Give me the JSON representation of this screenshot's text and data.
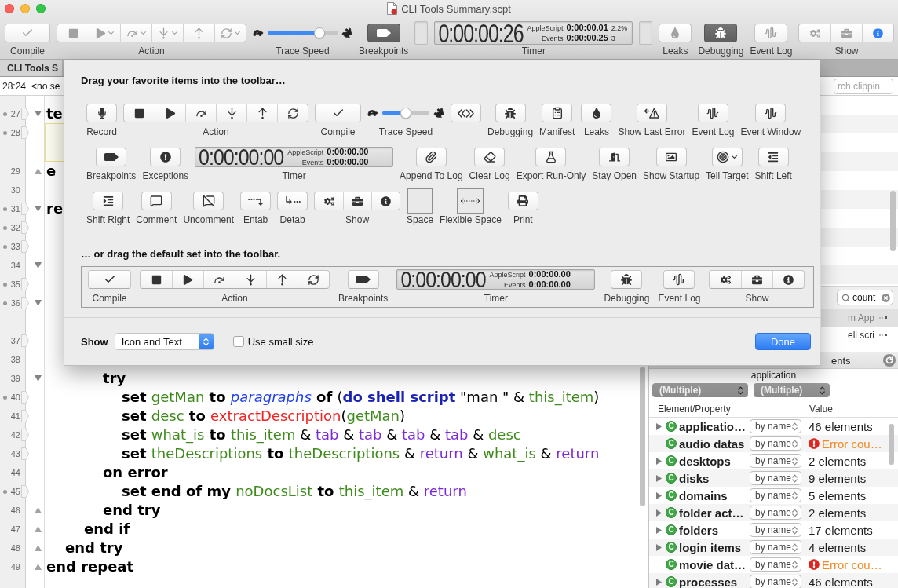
{
  "window": {
    "title": "CLI Tools Summary.scpt"
  },
  "toolbar": {
    "items": [
      {
        "kind": "compile",
        "label": "Compile",
        "disabled": true,
        "on": false
      },
      {
        "kind": "action",
        "label": "Action",
        "segments": [
          {
            "kind": "stop",
            "menu": false,
            "disabled": true
          },
          {
            "kind": "run",
            "menu": true,
            "disabled": true
          },
          {
            "kind": "stepover",
            "menu": true,
            "disabled": true
          },
          {
            "kind": "stepinto",
            "menu": true,
            "disabled": true
          },
          {
            "kind": "stepout",
            "menu": false,
            "disabled": true
          },
          {
            "kind": "loop",
            "menu": true,
            "disabled": true
          }
        ]
      },
      {
        "kind": "speed",
        "label": "Trace Speed",
        "level": 0.78
      },
      {
        "kind": "breakpoints",
        "label": "Breakpoints",
        "disabled": false,
        "on": true
      },
      {
        "kind": "flexspace"
      },
      {
        "kind": "timer",
        "label": "Timer",
        "display": "0:00:00:26",
        "script_label": "AppleScript",
        "script_time": "0:00:00.01",
        "script_share": "2.2%",
        "events_label": "Events",
        "events_time": "0:00:00.25",
        "events_count": "3"
      },
      {
        "kind": "flexspace"
      },
      {
        "kind": "leaks",
        "label": "Leaks",
        "disabled": true,
        "on": false
      },
      {
        "kind": "debugging",
        "label": "Debugging",
        "disabled": false,
        "on": true
      },
      {
        "kind": "eventlog",
        "label": "Event Log",
        "disabled": true,
        "on": false
      },
      {
        "kind": "show",
        "label": "Show",
        "segments": [
          {
            "kind": "library",
            "selected": false
          },
          {
            "kind": "bundle",
            "selected": false
          },
          {
            "kind": "inspector",
            "selected": true
          }
        ]
      }
    ]
  },
  "tabs": [
    {
      "label": "CLI Tools S",
      "selected": true
    }
  ],
  "navigation_bar": {
    "position": "28:24",
    "handler": "<no se"
  },
  "editor": {
    "lines": [
      {
        "number": "27",
        "dot": true,
        "marker": true,
        "wrapped": false,
        "highlighted": false,
        "opens": true,
        "closes": false,
        "tokens": [
          {
            "kind": "keyword",
            "text": "te"
          }
        ]
      },
      {
        "number": "28",
        "dot": true,
        "marker": true,
        "wrapped": true,
        "highlighted": true,
        "opens": false,
        "closes": false
      },
      {
        "number": "29",
        "dot": false,
        "marker": false,
        "wrapped": false,
        "highlighted": false,
        "opens": false,
        "closes": true,
        "tokens": [
          {
            "kind": "keyword",
            "text": "e"
          }
        ]
      },
      {
        "number": "30",
        "dot": false,
        "marker": false,
        "wrapped": false,
        "highlighted": false,
        "opens": false,
        "closes": false
      },
      {
        "number": "31",
        "dot": true,
        "marker": true,
        "wrapped": false,
        "highlighted": false,
        "opens": true,
        "closes": false,
        "tokens": [
          {
            "kind": "keyword",
            "text": "re"
          }
        ],
        "children": [
          {
            "number": "32",
            "dot": true,
            "marker": true,
            "wrapped": false,
            "highlighted": false,
            "opens": false,
            "closes": false
          },
          {
            "number": "33",
            "dot": true,
            "marker": true,
            "wrapped": false,
            "highlighted": false,
            "opens": false,
            "closes": false
          },
          {
            "number": "34",
            "dot": false,
            "marker": false,
            "wrapped": false,
            "highlighted": false,
            "opens": true,
            "closes": false,
            "children": [
              {
                "number": "35",
                "dot": true,
                "marker": true,
                "wrapped": false,
                "highlighted": false,
                "opens": false,
                "closes": false
              },
              {
                "number": "36",
                "dot": true,
                "marker": true,
                "wrapped": true,
                "highlighted": false,
                "opens": true,
                "closes": false,
                "children": [
                  {
                    "number": "37",
                    "dot": false,
                    "marker": true,
                    "wrapped": false,
                    "highlighted": false,
                    "opens": false,
                    "closes": false
                  },
                  {
                    "number": "38",
                    "dot": false,
                    "marker": false,
                    "wrapped": false,
                    "highlighted": false,
                    "opens": false,
                    "closes": false
                  },
                  {
                    "number": "39",
                    "dot": false,
                    "marker": false,
                    "wrapped": false,
                    "highlighted": false,
                    "opens": true,
                    "closes": false,
                    "tokens": [
                      {
                        "kind": "keyword",
                        "text": "try"
                      }
                    ],
                    "children": [
                      {
                        "number": "40",
                        "dot": true,
                        "marker": true,
                        "wrapped": false,
                        "highlighted": false,
                        "opens": false,
                        "closes": false,
                        "tokens": [
                          {
                            "kind": "keyword",
                            "text": "set "
                          },
                          {
                            "kind": "variable",
                            "text": "getMan"
                          },
                          {
                            "kind": "keyword",
                            "text": " to "
                          },
                          {
                            "kind": "class",
                            "text": "paragraphs"
                          },
                          {
                            "kind": "keyword",
                            "text": " of "
                          },
                          {
                            "kind": "plain",
                            "text": "("
                          },
                          {
                            "kind": "command",
                            "text": "do shell script"
                          },
                          {
                            "kind": "plain",
                            "text": " \"man \" & "
                          },
                          {
                            "kind": "variable",
                            "text": "this_item"
                          },
                          {
                            "kind": "plain",
                            "text": ")"
                          }
                        ]
                      },
                      {
                        "number": "41",
                        "dot": false,
                        "marker": true,
                        "wrapped": false,
                        "highlighted": false,
                        "opens": false,
                        "closes": false,
                        "tokens": [
                          {
                            "kind": "keyword",
                            "text": "set "
                          },
                          {
                            "kind": "variable",
                            "text": "desc"
                          },
                          {
                            "kind": "keyword",
                            "text": " to "
                          },
                          {
                            "kind": "handler",
                            "text": "extractDescription"
                          },
                          {
                            "kind": "plain",
                            "text": "("
                          },
                          {
                            "kind": "variable",
                            "text": "getMan"
                          },
                          {
                            "kind": "plain",
                            "text": ")"
                          }
                        ]
                      },
                      {
                        "number": "42",
                        "dot": false,
                        "marker": true,
                        "wrapped": false,
                        "highlighted": false,
                        "opens": false,
                        "closes": false,
                        "tokens": [
                          {
                            "kind": "keyword",
                            "text": "set "
                          },
                          {
                            "kind": "variable",
                            "text": "what_is"
                          },
                          {
                            "kind": "keyword",
                            "text": " to "
                          },
                          {
                            "kind": "variable",
                            "text": "this_item"
                          },
                          {
                            "kind": "plain",
                            "text": " & "
                          },
                          {
                            "kind": "constant",
                            "text": "tab"
                          },
                          {
                            "kind": "plain",
                            "text": " & "
                          },
                          {
                            "kind": "constant",
                            "text": "tab"
                          },
                          {
                            "kind": "plain",
                            "text": " & "
                          },
                          {
                            "kind": "constant",
                            "text": "tab"
                          },
                          {
                            "kind": "plain",
                            "text": " & "
                          },
                          {
                            "kind": "constant",
                            "text": "tab"
                          },
                          {
                            "kind": "plain",
                            "text": " & "
                          },
                          {
                            "kind": "variable",
                            "text": "desc"
                          }
                        ]
                      },
                      {
                        "number": "43",
                        "dot": false,
                        "marker": true,
                        "wrapped": false,
                        "highlighted": false,
                        "opens": false,
                        "closes": false,
                        "tokens": [
                          {
                            "kind": "keyword",
                            "text": "set "
                          },
                          {
                            "kind": "variable",
                            "text": "theDescriptions"
                          },
                          {
                            "kind": "keyword",
                            "text": " to "
                          },
                          {
                            "kind": "variable",
                            "text": "theDescriptions"
                          },
                          {
                            "kind": "plain",
                            "text": " & "
                          },
                          {
                            "kind": "constant",
                            "text": "return"
                          },
                          {
                            "kind": "plain",
                            "text": " & "
                          },
                          {
                            "kind": "variable",
                            "text": "what_is"
                          },
                          {
                            "kind": "plain",
                            "text": " & "
                          },
                          {
                            "kind": "constant",
                            "text": "return"
                          }
                        ]
                      }
                    ]
                  },
                  {
                    "number": "44",
                    "dot": false,
                    "marker": false,
                    "wrapped": false,
                    "highlighted": false,
                    "opens": false,
                    "closes": false,
                    "tokens": [
                      {
                        "kind": "keyword",
                        "text": "on error"
                      }
                    ],
                    "children": [
                      {
                        "number": "45",
                        "dot": true,
                        "marker": true,
                        "wrapped": false,
                        "highlighted": false,
                        "opens": false,
                        "closes": false,
                        "tokens": [
                          {
                            "kind": "keyword",
                            "text": "set end of my "
                          },
                          {
                            "kind": "variable",
                            "text": "noDocsList"
                          },
                          {
                            "kind": "keyword",
                            "text": " to "
                          },
                          {
                            "kind": "variable",
                            "text": "this_item"
                          },
                          {
                            "kind": "plain",
                            "text": " & "
                          },
                          {
                            "kind": "constant",
                            "text": "return"
                          }
                        ]
                      }
                    ]
                  },
                  {
                    "number": "46",
                    "dot": false,
                    "marker": false,
                    "wrapped": false,
                    "highlighted": false,
                    "opens": false,
                    "closes": true,
                    "tokens": [
                      {
                        "kind": "keyword",
                        "text": "end try"
                      }
                    ]
                  }
                ]
              },
              {
                "number": "47",
                "dot": false,
                "marker": false,
                "wrapped": false,
                "highlighted": false,
                "opens": false,
                "closes": true,
                "tokens": [
                  {
                    "kind": "keyword",
                    "text": "end if"
                  }
                ]
              }
            ]
          },
          {
            "number": "48",
            "dot": false,
            "marker": false,
            "wrapped": false,
            "highlighted": false,
            "opens": false,
            "closes": true,
            "tokens": [
              {
                "kind": "keyword",
                "text": "end try"
              }
            ]
          }
        ]
      },
      {
        "number": "49",
        "dot": false,
        "marker": false,
        "wrapped": false,
        "highlighted": false,
        "opens": false,
        "closes": true,
        "tokens": [
          {
            "kind": "keyword",
            "text": "end repeat"
          }
        ]
      }
    ]
  },
  "side_panel": {
    "search": {
      "placeholder": "rch clippin"
    },
    "filter": {
      "value": "count"
    },
    "results": [
      {
        "text": "m App",
        "selected": true
      },
      {
        "text": "ell scri",
        "selected": false
      }
    ],
    "section": "ents",
    "object": "application",
    "popups": [
      "(Multiple)",
      "(Multiple)"
    ],
    "table": {
      "columns": [
        "Element/Property",
        "Value"
      ],
      "rows": [
        {
          "name": "applicatio…",
          "badge": "C",
          "expandable": true,
          "access": "by name",
          "value": "46 elements",
          "error": false
        },
        {
          "name": "audio datas",
          "badge": "C",
          "expandable": false,
          "access": "by name",
          "value": "Error cou…",
          "error": true
        },
        {
          "name": "desktops",
          "badge": "C",
          "expandable": true,
          "access": "by name",
          "value": "2 elements",
          "error": false
        },
        {
          "name": "disks",
          "badge": "C",
          "expandable": true,
          "access": "by name",
          "value": "9 elements",
          "error": false
        },
        {
          "name": "domains",
          "badge": "C",
          "expandable": true,
          "access": "by name",
          "value": "5 elements",
          "error": false
        },
        {
          "name": "folder act…",
          "badge": "C",
          "expandable": true,
          "access": "by name",
          "value": "2 elements",
          "error": false
        },
        {
          "name": "folders",
          "badge": "C",
          "expandable": true,
          "access": "by name",
          "value": "17 elements",
          "error": false
        },
        {
          "name": "login items",
          "badge": "C",
          "expandable": true,
          "access": "by name",
          "value": "4 elements",
          "error": false
        },
        {
          "name": "movie dat…",
          "badge": "C",
          "expandable": false,
          "access": "by name",
          "value": "Error cou…",
          "error": true
        },
        {
          "name": "processes",
          "badge": "C",
          "expandable": true,
          "access": "by name",
          "value": "46 elements",
          "error": false
        }
      ]
    }
  },
  "customize_sheet": {
    "heading": "Drag your favorite items into the toolbar…",
    "palette": {
      "rows": [
        {
          "items": [
            {
              "kind": "record",
              "label": "Record"
            },
            {
              "kind": "action",
              "label": "Action",
              "segments": [
                {
                  "kind": "stop"
                },
                {
                  "kind": "run"
                },
                {
                  "kind": "stepover"
                },
                {
                  "kind": "stepinto"
                },
                {
                  "kind": "stepout"
                },
                {
                  "kind": "loop"
                }
              ]
            },
            {
              "kind": "compile",
              "label": "Compile"
            },
            {
              "kind": "speed",
              "label": "Trace Speed",
              "level": 0.5
            },
            {
              "kind": "chevrons"
            },
            {
              "kind": "debugging",
              "label": "Debugging"
            },
            {
              "kind": "manifest",
              "label": "Manifest"
            },
            {
              "kind": "leaks",
              "label": "Leaks"
            },
            {
              "kind": "lasterror",
              "label": "Show Last Error"
            },
            {
              "kind": "eventlog",
              "label": "Event Log"
            },
            {
              "kind": "eventwindow",
              "label": "Event Window"
            }
          ]
        },
        {
          "items": [
            {
              "kind": "breakpoints",
              "label": "Breakpoints"
            },
            {
              "kind": "exceptions",
              "label": "Exceptions"
            },
            {
              "kind": "timer",
              "label": "Timer",
              "display": "0:00:00:00",
              "script_label": "AppleScript",
              "script_time": "0:00:00.00",
              "events_label": "Events",
              "events_time": "0:00:00.00"
            },
            {
              "kind": "appendlog",
              "label": "Append To Log"
            },
            {
              "kind": "clearlog",
              "label": "Clear Log"
            },
            {
              "kind": "exportrunonly",
              "label": "Export Run-Only"
            },
            {
              "kind": "stayopen",
              "label": "Stay Open"
            },
            {
              "kind": "showstartup",
              "label": "Show Startup"
            },
            {
              "kind": "telltarget",
              "label": "Tell Target"
            },
            {
              "kind": "shiftleft",
              "label": "Shift Left"
            }
          ]
        },
        {
          "items": [
            {
              "kind": "shiftright",
              "label": "Shift Right"
            },
            {
              "kind": "comment",
              "label": "Comment"
            },
            {
              "kind": "uncomment",
              "label": "Uncomment"
            },
            {
              "kind": "entab",
              "label": "Entab"
            },
            {
              "kind": "detab",
              "label": "Detab"
            },
            {
              "kind": "show",
              "label": "Show",
              "segments": [
                {
                  "kind": "library"
                },
                {
                  "kind": "bundle"
                },
                {
                  "kind": "inspector"
                }
              ]
            },
            {
              "kind": "space",
              "label": "Space"
            },
            {
              "kind": "flexspace",
              "label": "Flexible Space"
            },
            {
              "kind": "print",
              "label": "Print"
            }
          ]
        }
      ]
    },
    "default_heading": "… or drag the default set into the toolbar.",
    "default_set": {
      "items": [
        {
          "kind": "compile",
          "label": "Compile"
        },
        {
          "kind": "action",
          "label": "Action",
          "segments": [
            {
              "kind": "stop"
            },
            {
              "kind": "run"
            },
            {
              "kind": "stepover"
            },
            {
              "kind": "stepinto"
            },
            {
              "kind": "stepout"
            },
            {
              "kind": "loop"
            }
          ]
        },
        {
          "kind": "breakpoints",
          "label": "Breakpoints"
        },
        {
          "kind": "timer",
          "label": "Timer",
          "display": "0:00:00:00",
          "script_label": "AppleScript",
          "script_time": "0:00:00.00",
          "events_label": "Events",
          "events_time": "0:00:00.00"
        },
        {
          "kind": "debugging",
          "label": "Debugging"
        },
        {
          "kind": "eventlog",
          "label": "Event Log"
        },
        {
          "kind": "show",
          "label": "Show",
          "segments": [
            {
              "kind": "library"
            },
            {
              "kind": "bundle"
            },
            {
              "kind": "inspector"
            }
          ]
        }
      ]
    },
    "show_label": "Show",
    "show_popup": {
      "value": "Icon and Text"
    },
    "small_size": {
      "label": "Use small size",
      "checked": false
    },
    "done_button": "Done"
  }
}
